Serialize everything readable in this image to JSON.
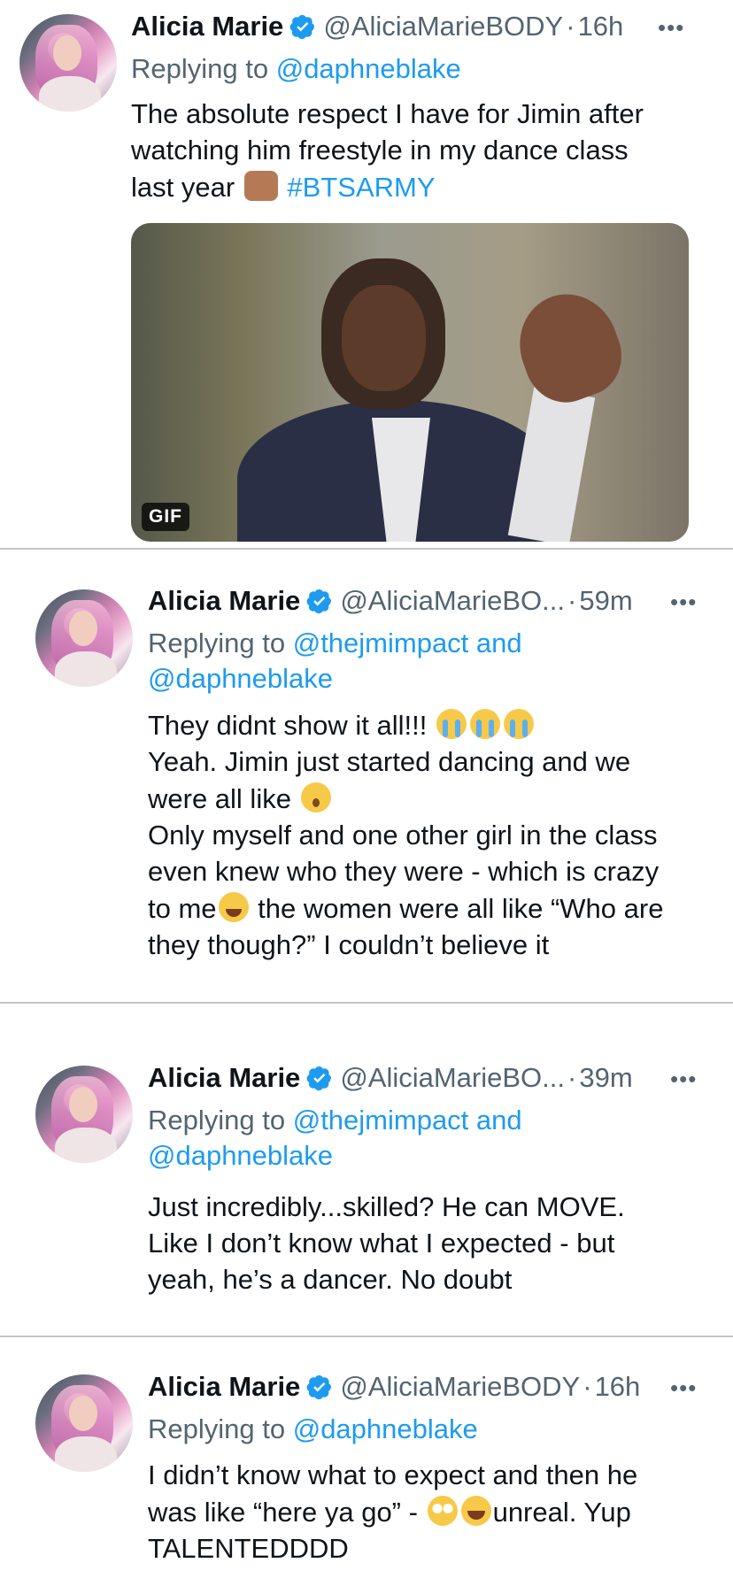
{
  "tweets": [
    {
      "name": "Alicia Marie",
      "handle": "@AliciaMarieBODY",
      "time": "16h",
      "replying": "Replying to",
      "reply_to": "@daphneblake",
      "lines": [
        "The absolute respect I have for Jimin after",
        "watching him freestyle in my dance class"
      ],
      "last_line_text": "last year",
      "hashtag": "#BTSARMY",
      "media": {
        "badge": "GIF"
      }
    },
    {
      "name": "Alicia Marie",
      "handle": "@AliciaMarieBO...",
      "time": "59m",
      "replying": "Replying to",
      "reply_to": "@thejmimpact and",
      "reply_to2": "@daphneblake",
      "line1": "They didnt show it all!!!",
      "line2": "Yeah. Jimin just started dancing and we",
      "line3": "were all like",
      "line4": "Only myself and one other girl in the class",
      "line5": "even knew who they were - which is crazy",
      "line6a": "to me",
      "line6b": " the women were all like “Who are",
      "line7": "they though?” I couldn’t believe it"
    },
    {
      "name": "Alicia Marie",
      "handle": "@AliciaMarieBO...",
      "time": "39m",
      "replying": "Replying to",
      "reply_to": "@thejmimpact and",
      "reply_to2": "@daphneblake",
      "lines": [
        "Just incredibly...skilled? He can MOVE.",
        "Like I don’t know what I expected - but",
        "yeah, he’s a dancer. No doubt"
      ]
    },
    {
      "name": "Alicia Marie",
      "handle": "@AliciaMarieBODY",
      "time": "16h",
      "replying": "Replying to",
      "reply_to": "@daphneblake",
      "line1": "I didn’t know what to expect and then he",
      "line2a": "was like “here ya go” -",
      "line2b": "unreal. Yup",
      "line3": "TALENTEDDDD"
    }
  ],
  "ui": {
    "dot": "·",
    "more": "•••",
    "verified_color": "#1d9bf0",
    "link_color": "#1d9bf0"
  }
}
